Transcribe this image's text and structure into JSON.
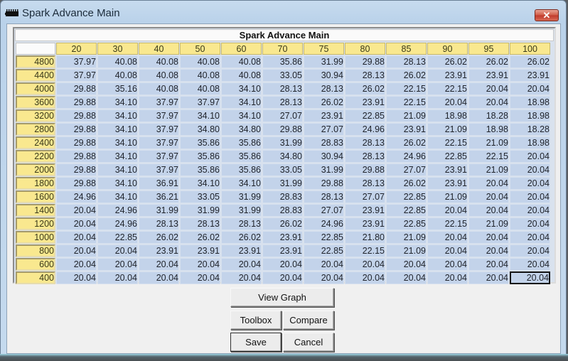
{
  "window": {
    "title": "Spark Advance Main",
    "icon": "chip-icon",
    "close_label": "✕"
  },
  "table": {
    "title": "Spark Advance Main",
    "column_headers": [
      "20",
      "30",
      "40",
      "50",
      "60",
      "70",
      "75",
      "80",
      "85",
      "90",
      "95",
      "100"
    ],
    "selected_cell": {
      "row": "400",
      "column": "100"
    },
    "rows": [
      {
        "rpm": "4800",
        "values": [
          "37.97",
          "40.08",
          "40.08",
          "40.08",
          "40.08",
          "35.86",
          "31.99",
          "29.88",
          "28.13",
          "26.02",
          "26.02",
          "26.02"
        ]
      },
      {
        "rpm": "4400",
        "values": [
          "37.97",
          "40.08",
          "40.08",
          "40.08",
          "40.08",
          "33.05",
          "30.94",
          "28.13",
          "26.02",
          "23.91",
          "23.91",
          "23.91"
        ]
      },
      {
        "rpm": "4000",
        "values": [
          "29.88",
          "35.16",
          "40.08",
          "40.08",
          "34.10",
          "28.13",
          "28.13",
          "26.02",
          "22.15",
          "22.15",
          "20.04",
          "20.04"
        ]
      },
      {
        "rpm": "3600",
        "values": [
          "29.88",
          "34.10",
          "37.97",
          "37.97",
          "34.10",
          "28.13",
          "26.02",
          "23.91",
          "22.15",
          "20.04",
          "20.04",
          "18.98"
        ]
      },
      {
        "rpm": "3200",
        "values": [
          "29.88",
          "34.10",
          "37.97",
          "34.10",
          "34.10",
          "27.07",
          "23.91",
          "22.85",
          "21.09",
          "18.98",
          "18.28",
          "18.98"
        ]
      },
      {
        "rpm": "2800",
        "values": [
          "29.88",
          "34.10",
          "37.97",
          "34.80",
          "34.80",
          "29.88",
          "27.07",
          "24.96",
          "23.91",
          "21.09",
          "18.98",
          "18.28"
        ]
      },
      {
        "rpm": "2400",
        "values": [
          "29.88",
          "34.10",
          "37.97",
          "35.86",
          "35.86",
          "31.99",
          "28.83",
          "28.13",
          "26.02",
          "22.15",
          "21.09",
          "18.98"
        ]
      },
      {
        "rpm": "2200",
        "values": [
          "29.88",
          "34.10",
          "37.97",
          "35.86",
          "35.86",
          "34.80",
          "30.94",
          "28.13",
          "24.96",
          "22.85",
          "22.15",
          "20.04"
        ]
      },
      {
        "rpm": "2000",
        "values": [
          "29.88",
          "34.10",
          "37.97",
          "35.86",
          "35.86",
          "33.05",
          "31.99",
          "29.88",
          "27.07",
          "23.91",
          "21.09",
          "20.04"
        ]
      },
      {
        "rpm": "1800",
        "values": [
          "29.88",
          "34.10",
          "36.91",
          "34.10",
          "34.10",
          "31.99",
          "29.88",
          "28.13",
          "26.02",
          "23.91",
          "20.04",
          "20.04"
        ]
      },
      {
        "rpm": "1600",
        "values": [
          "24.96",
          "34.10",
          "36.21",
          "33.05",
          "31.99",
          "28.83",
          "28.13",
          "27.07",
          "22.85",
          "21.09",
          "20.04",
          "20.04"
        ]
      },
      {
        "rpm": "1400",
        "values": [
          "20.04",
          "24.96",
          "31.99",
          "31.99",
          "31.99",
          "28.83",
          "27.07",
          "23.91",
          "22.85",
          "20.04",
          "20.04",
          "20.04"
        ]
      },
      {
        "rpm": "1200",
        "values": [
          "20.04",
          "24.96",
          "28.13",
          "28.13",
          "28.13",
          "26.02",
          "24.96",
          "23.91",
          "22.85",
          "22.15",
          "21.09",
          "20.04"
        ]
      },
      {
        "rpm": "1000",
        "values": [
          "20.04",
          "22.85",
          "26.02",
          "26.02",
          "26.02",
          "23.91",
          "22.85",
          "21.80",
          "21.09",
          "20.04",
          "20.04",
          "20.04"
        ]
      },
      {
        "rpm": "800",
        "values": [
          "20.04",
          "20.04",
          "23.91",
          "23.91",
          "23.91",
          "23.91",
          "22.85",
          "22.15",
          "21.09",
          "20.04",
          "20.04",
          "20.04"
        ]
      },
      {
        "rpm": "600",
        "values": [
          "20.04",
          "20.04",
          "20.04",
          "20.04",
          "20.04",
          "20.04",
          "20.04",
          "20.04",
          "20.04",
          "20.04",
          "20.04",
          "20.04"
        ]
      },
      {
        "rpm": "400",
        "values": [
          "20.04",
          "20.04",
          "20.04",
          "20.04",
          "20.04",
          "20.04",
          "20.04",
          "20.04",
          "20.04",
          "20.04",
          "20.04",
          "20.04"
        ]
      }
    ]
  },
  "buttons": {
    "view_graph": "View Graph",
    "toolbox": "Toolbox",
    "compare": "Compare",
    "save": "Save",
    "cancel": "Cancel"
  }
}
